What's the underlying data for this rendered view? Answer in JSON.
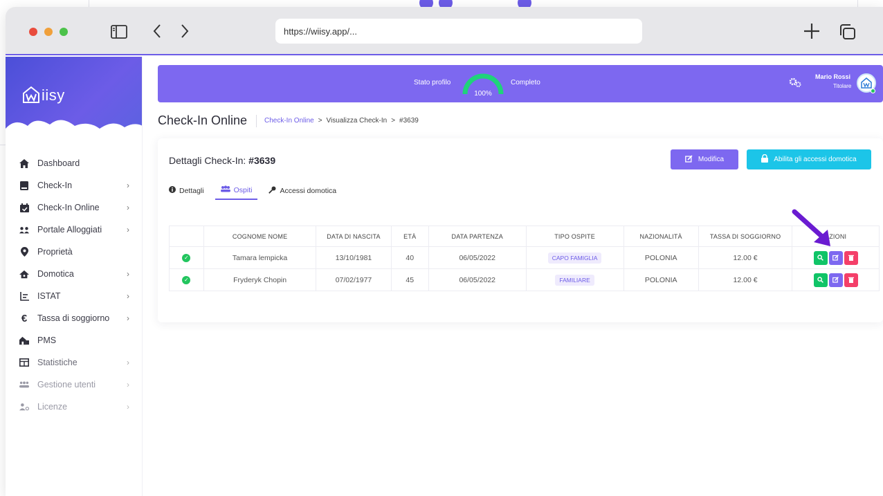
{
  "browser": {
    "url": "https://wiisy.app/..."
  },
  "brand": {
    "name": "Wiisy"
  },
  "sidebar": {
    "items": [
      {
        "label": "Dashboard",
        "icon": "home-icon",
        "chevron": false,
        "muted": false
      },
      {
        "label": "Check-In",
        "icon": "book-icon",
        "chevron": true,
        "muted": false
      },
      {
        "label": "Check-In Online",
        "icon": "calendar-check-icon",
        "chevron": true,
        "muted": false
      },
      {
        "label": "Portale Alloggiati",
        "icon": "users-icon",
        "chevron": true,
        "muted": false
      },
      {
        "label": "Proprietà",
        "icon": "map-pin-icon",
        "chevron": false,
        "muted": false
      },
      {
        "label": "Domotica",
        "icon": "smart-home-icon",
        "chevron": true,
        "muted": false
      },
      {
        "label": "ISTAT",
        "icon": "chart-icon",
        "chevron": true,
        "muted": false
      },
      {
        "label": "Tassa di soggiorno",
        "icon": "euro-icon",
        "chevron": true,
        "muted": false
      },
      {
        "label": "PMS",
        "icon": "building-icon",
        "chevron": false,
        "muted": false
      },
      {
        "label": "Statistiche",
        "icon": "table-icon",
        "chevron": true,
        "muted": true
      },
      {
        "label": "Gestione utenti",
        "icon": "user-group-icon",
        "chevron": true,
        "muted": true
      },
      {
        "label": "Licenze",
        "icon": "license-icon",
        "chevron": true,
        "muted": true
      }
    ]
  },
  "topbar": {
    "stato_label": "Stato profilo",
    "progress": "100%",
    "completo_label": "Completo",
    "user_name": "Mario Rossi",
    "user_role": "Titolare"
  },
  "page": {
    "title": "Check-In Online",
    "breadcrumb": [
      "Check-In Online",
      ">",
      "Visualizza Check-In",
      ">",
      "#3639"
    ]
  },
  "card": {
    "title_prefix": "Dettagli Check-In: ",
    "title_id": "#3639",
    "modifica_label": "Modifica",
    "domotica_label": "Abilita gli accessi domotica",
    "tabs": [
      "Dettagli",
      "Ospiti",
      "Accessi domotica"
    ],
    "active_tab": "Ospiti"
  },
  "table": {
    "headers": [
      "",
      "COGNOME NOME",
      "DATA DI NASCITA",
      "ETÀ",
      "DATA PARTENZA",
      "TIPO OSPITE",
      "NAZIONALITÀ",
      "TASSA DI SOGGIORNO",
      "AZIONI"
    ],
    "rows": [
      {
        "name": "Tamara lempicka",
        "birth": "13/10/1981",
        "age": "40",
        "departure": "06/05/2022",
        "type": "CAPO FAMIGLIA",
        "nationality": "POLONIA",
        "tax": "12.00 €"
      },
      {
        "name": "Fryderyk Chopin",
        "birth": "07/02/1977",
        "age": "45",
        "departure": "06/05/2022",
        "type": "FAMILIARE",
        "nationality": "POLONIA",
        "tax": "12.00 €"
      }
    ]
  },
  "colors": {
    "accent": "#7d68f0",
    "cyan": "#1cc5e8",
    "green": "#10c467",
    "red": "#f43f69"
  }
}
